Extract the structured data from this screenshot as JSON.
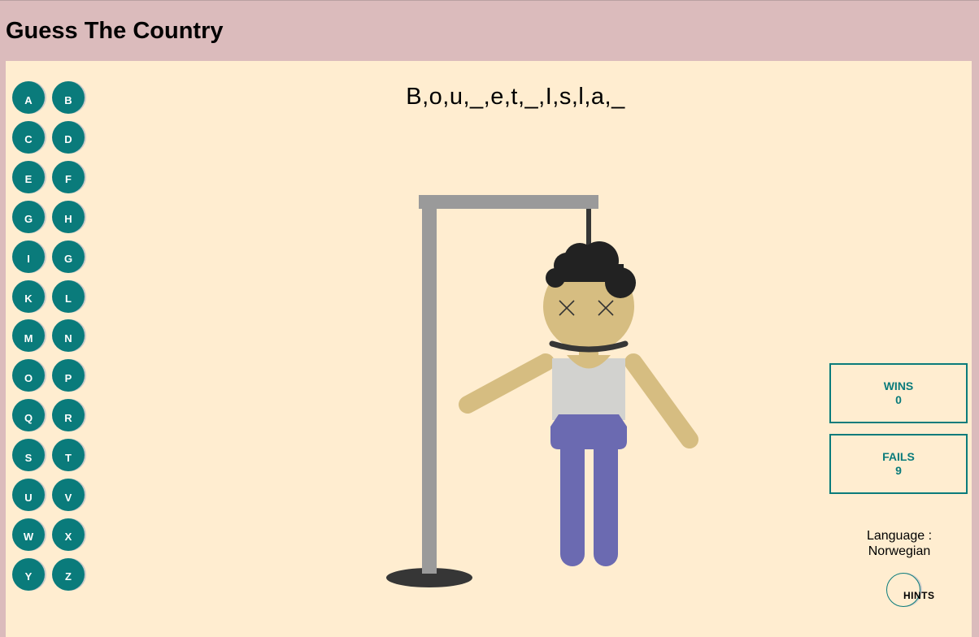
{
  "header": {
    "title": "Guess The Country"
  },
  "game": {
    "word_display": "B,o,u,_,e,t,_,I,s,l,a,_"
  },
  "letters": [
    "A",
    "B",
    "C",
    "D",
    "E",
    "F",
    "G",
    "H",
    "I",
    "G",
    "K",
    "L",
    "M",
    "N",
    "O",
    "P",
    "Q",
    "R",
    "S",
    "T",
    "U",
    "V",
    "W",
    "X",
    "Y",
    "Z"
  ],
  "stats": {
    "wins_label": "WINS",
    "wins_value": "0",
    "fails_label": "FAILS",
    "fails_value": "9"
  },
  "language": {
    "label": "Language :",
    "value": "Norwegian"
  },
  "hints": {
    "label": "HINTS"
  },
  "colors": {
    "accent": "#0a7b7b",
    "header_bg": "#dbbbbc",
    "board_bg": "#ffedd0",
    "gallows": "#9a9a9a",
    "skin": "#d6bd81",
    "hair": "#222222",
    "shirt": "#d2d2cf",
    "pants": "#6b6ab1"
  }
}
